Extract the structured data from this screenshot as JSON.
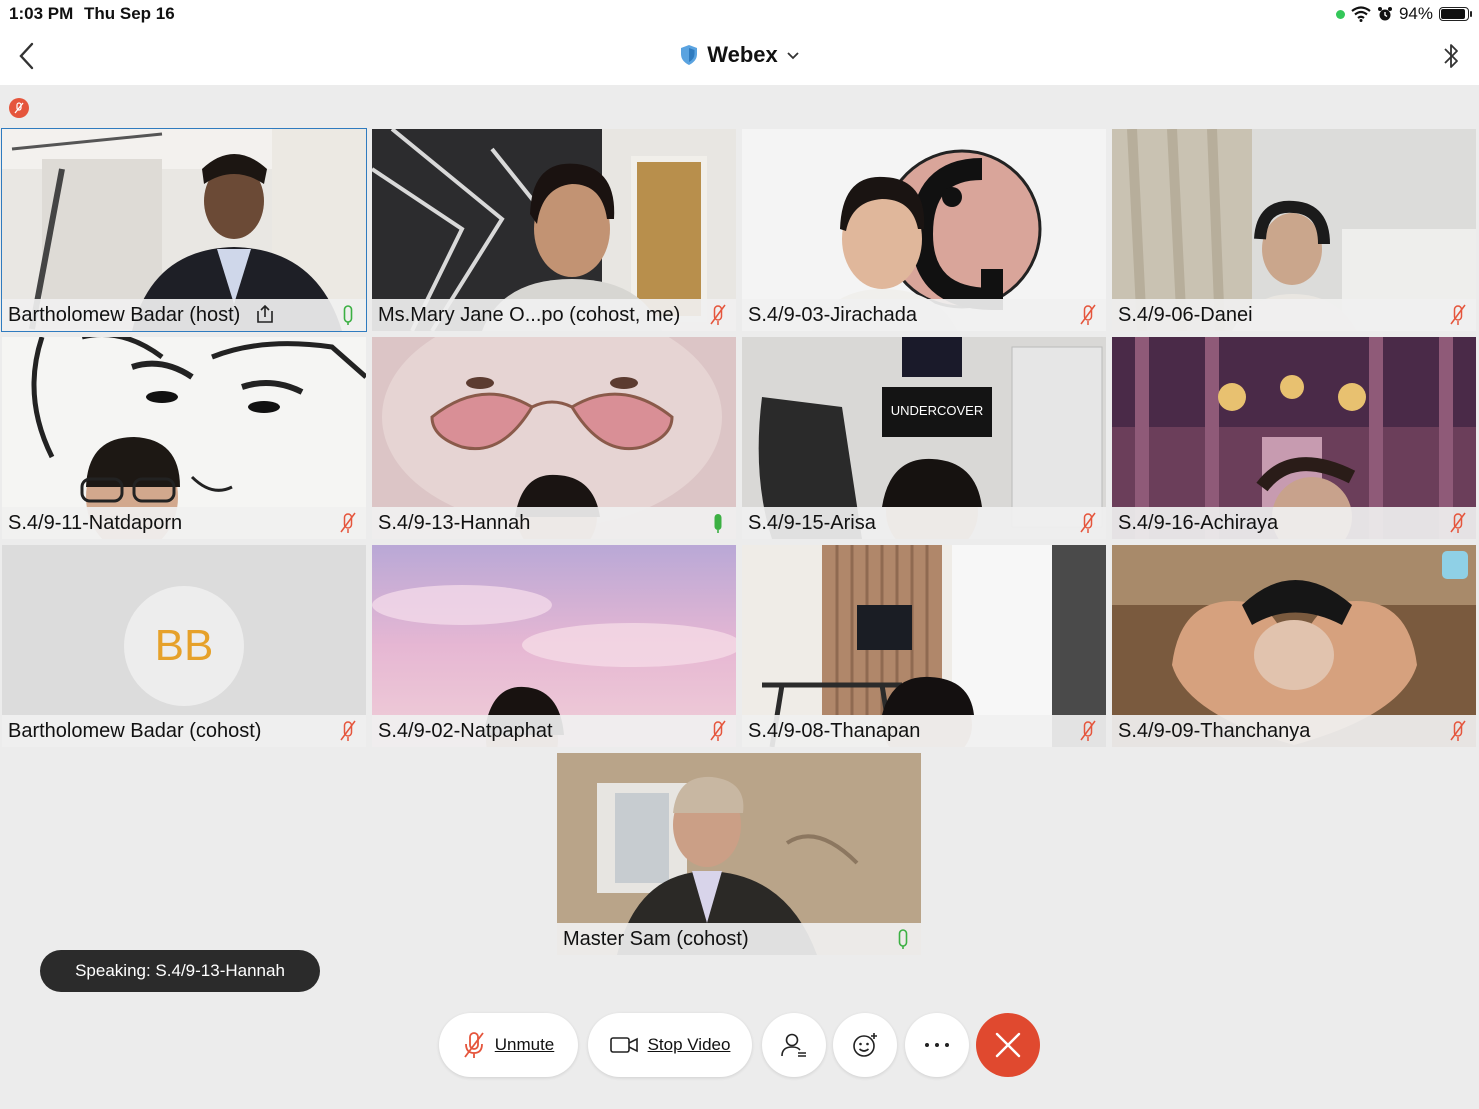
{
  "status_bar": {
    "time": "1:03 PM",
    "date": "Thu Sep 16",
    "battery": "94%",
    "icons": [
      "wifi-icon",
      "alarm-icon",
      "battery-icon"
    ]
  },
  "header": {
    "title": "Webex",
    "icons": [
      "back-chevron-icon",
      "shield-icon",
      "chevron-down-icon",
      "bluetooth-icon"
    ]
  },
  "participants": [
    {
      "name": "Bartholomew Badar (host)",
      "mic": "on",
      "sharing": true,
      "active": true
    },
    {
      "name": "Ms.Mary Jane O...po (cohost, me)",
      "mic": "muted"
    },
    {
      "name": "S.4/9-03-Jirachada",
      "mic": "muted"
    },
    {
      "name": "S.4/9-06-Danei",
      "mic": "muted"
    },
    {
      "name": "S.4/9-11-Natdaporn",
      "mic": "muted"
    },
    {
      "name": "S.4/9-13-Hannah",
      "mic": "on"
    },
    {
      "name": "S.4/9-15-Arisa",
      "mic": "muted"
    },
    {
      "name": "S.4/9-16-Achiraya",
      "mic": "muted"
    },
    {
      "name": "Bartholomew Badar (cohost)",
      "mic": "muted",
      "avatar_initials": "BB"
    },
    {
      "name": "S.4/9-02-Natpaphat",
      "mic": "muted"
    },
    {
      "name": "S.4/9-08-Thanapan",
      "mic": "muted"
    },
    {
      "name": "S.4/9-09-Thanchanya",
      "mic": "muted"
    },
    {
      "name": "Master Sam (cohost)",
      "mic": "on"
    }
  ],
  "speaking_toast": "Speaking: S.4/9-13-Hannah",
  "controls": {
    "unmute_label": "Unmute",
    "stop_video_label": "Stop Video",
    "icons": [
      "mic-muted-icon",
      "video-camera-icon",
      "participants-icon",
      "reactions-icon",
      "more-icon",
      "end-call-icon"
    ]
  },
  "colors": {
    "accent_blue": "#2f7bbf",
    "mute_red": "#e5553c",
    "mic_green": "#3cb043",
    "end_call": "#e0492f",
    "avatar_text": "#e6a12a"
  }
}
